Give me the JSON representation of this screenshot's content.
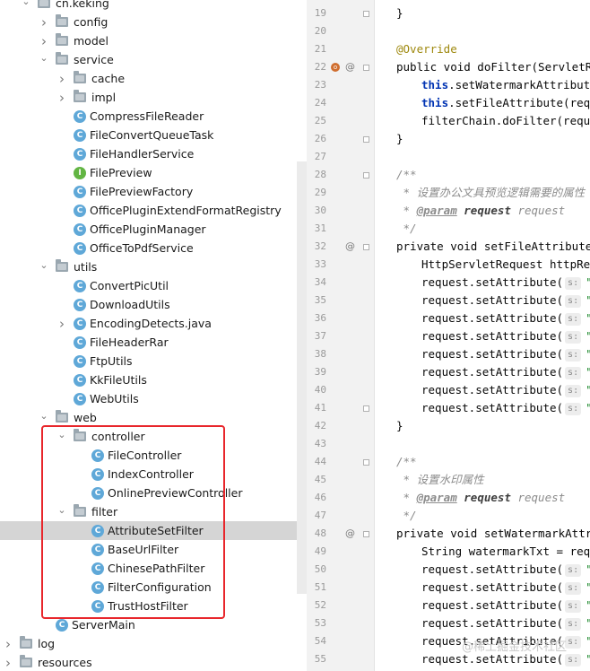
{
  "tree": {
    "items": [
      {
        "label": "cn.keking"
      },
      {
        "label": "config"
      },
      {
        "label": "model"
      },
      {
        "label": "service"
      },
      {
        "label": "cache"
      },
      {
        "label": "impl"
      },
      {
        "label": "CompressFileReader"
      },
      {
        "label": "FileConvertQueueTask"
      },
      {
        "label": "FileHandlerService"
      },
      {
        "label": "FilePreview"
      },
      {
        "label": "FilePreviewFactory"
      },
      {
        "label": "OfficePluginExtendFormatRegistry"
      },
      {
        "label": "OfficePluginManager"
      },
      {
        "label": "OfficeToPdfService"
      },
      {
        "label": "utils"
      },
      {
        "label": "ConvertPicUtil"
      },
      {
        "label": "DownloadUtils"
      },
      {
        "label": "EncodingDetects.java"
      },
      {
        "label": "FileHeaderRar"
      },
      {
        "label": "FtpUtils"
      },
      {
        "label": "KkFileUtils"
      },
      {
        "label": "WebUtils"
      },
      {
        "label": "web"
      },
      {
        "label": "controller"
      },
      {
        "label": "FileController"
      },
      {
        "label": "IndexController"
      },
      {
        "label": "OnlinePreviewController"
      },
      {
        "label": "filter"
      },
      {
        "label": "AttributeSetFilter"
      },
      {
        "label": "BaseUrlFilter"
      },
      {
        "label": "ChinesePathFilter"
      },
      {
        "label": "FilterConfiguration"
      },
      {
        "label": "TrustHostFilter"
      },
      {
        "label": "ServerMain"
      },
      {
        "label": "log"
      },
      {
        "label": "resources"
      }
    ],
    "selected": "AttributeSetFilter",
    "highlight_color": "#e8262b"
  },
  "gutter": {
    "line_numbers": [
      "19",
      "20",
      "21",
      "22",
      "23",
      "24",
      "25",
      "26",
      "27",
      "28",
      "29",
      "30",
      "31",
      "32",
      "33",
      "34",
      "35",
      "36",
      "37",
      "38",
      "39",
      "40",
      "41",
      "42",
      "43",
      "44",
      "45",
      "46",
      "47",
      "48",
      "49",
      "50",
      "51",
      "52",
      "53",
      "54",
      "55"
    ]
  },
  "code": {
    "comment_open": "/**",
    "comment_close": " */",
    "comment_star": " * ",
    "param_tag": "@param",
    "param_name": "request",
    "param_type": "request",
    "doc_1": "设置办公文具预览逻辑需要的属性",
    "doc_2": "设置水印属性",
    "override": "@Override",
    "close_brace": "}",
    "line_22": "public void doFilter(ServletRe",
    "line_23_a": "this",
    "line_23_b": ".setWatermarkAttribute(",
    "line_24_a": "this",
    "line_24_b": ".setFileAttribute(reque",
    "line_25": "filterChain.doFilter(reques",
    "line_32": "private void setFileAttribute(S",
    "line_33": "HttpServletRequest httpRequ",
    "line_48": "private void setWatermarkAttrib",
    "line_49": "String watermarkTxt = reque",
    "set_call": "request.setAttribute(",
    "hint": "s:",
    "strs_file": [
      "\"p",
      "\"p",
      "\"p",
      "\"p",
      "\"p",
      "\"f",
      "\"s",
      "\"f"
    ],
    "strs_wm": [
      "\"w",
      "\"w",
      "\"w",
      "\"w",
      "\"w",
      "\"w"
    ]
  },
  "watermark": "@稀土掘金技术社区"
}
